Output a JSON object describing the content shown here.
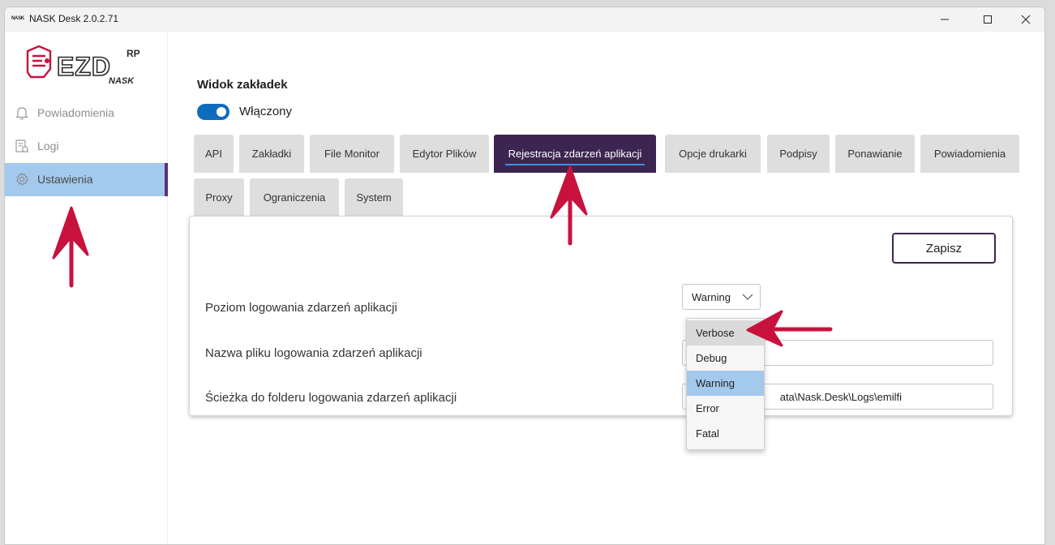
{
  "window": {
    "app_icon_text": "NASK",
    "title": "NASK Desk 2.0.2.71",
    "controls": [
      "minimize-icon",
      "maximize-icon",
      "close-icon"
    ]
  },
  "logo": {
    "main": "EZD",
    "sup": "RP",
    "sub": "NASK"
  },
  "sidebar": {
    "items": [
      {
        "label": "Powiadomienia",
        "icon": "bell-icon",
        "active": false
      },
      {
        "label": "Logi",
        "icon": "logs-icon",
        "active": false
      },
      {
        "label": "Ustawienia",
        "icon": "gear-icon",
        "active": true
      }
    ]
  },
  "settings": {
    "title": "Widok zakładek",
    "toggle_label": "Włączony",
    "toggle_on": true,
    "tabs_row1": [
      "API",
      "Zakładki",
      "File Monitor",
      "Edytor Plików",
      "Rejestracja zdarzeń aplikacji",
      "Opcje drukarki",
      "Podpisy",
      "Ponawianie",
      "Powiadomienia"
    ],
    "tabs_row2": [
      "Proxy",
      "Ograniczenia",
      "System"
    ],
    "active_tab": "Rejestracja zdarzeń aplikacji"
  },
  "panel": {
    "save_label": "Zapisz",
    "level_label": "Poziom logowania zdarzeń aplikacji",
    "level_value": "Warning",
    "filename_label": "Nazwa pliku logowania zdarzeń aplikacji",
    "filename_value": "",
    "path_label": "Ścieżka do folderu logowania zdarzeń aplikacji",
    "path_value": "ata\\Nask.Desk\\Logs\\emilfi"
  },
  "dropdown": {
    "options": [
      "Verbose",
      "Debug",
      "Warning",
      "Error",
      "Fatal"
    ],
    "hovered": "Verbose",
    "selected": "Warning"
  },
  "colors": {
    "accent_purple": "#3c2550",
    "selection_blue": "#a3c9ec",
    "toggle_blue": "#0f6cbd",
    "annotation_red": "#c8123e"
  }
}
